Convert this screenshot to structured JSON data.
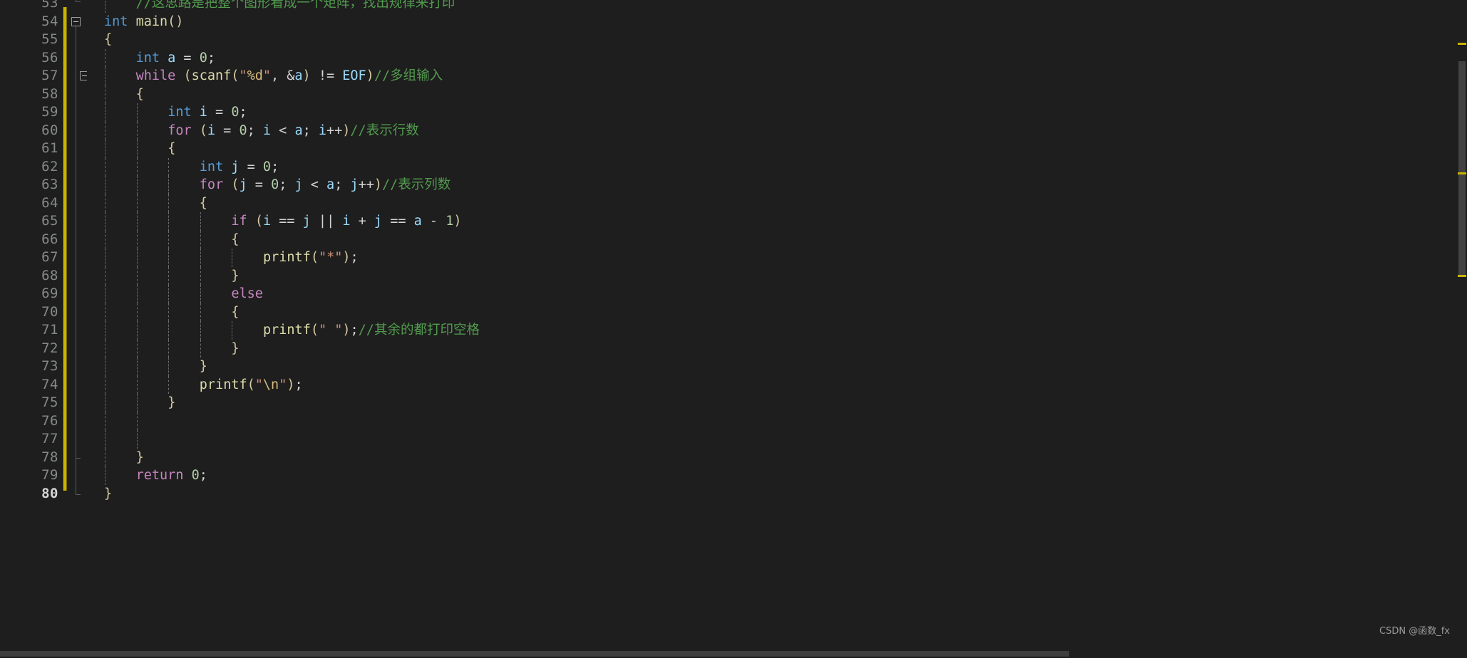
{
  "editor": {
    "theme": "dark-plus",
    "background": "#1e1e1e",
    "gutter_color": "#868989",
    "change_bar_color": "#c8b400",
    "language": "c",
    "first_visible_line": 53,
    "last_visible_line": 80,
    "current_line": 80
  },
  "watermark": {
    "text": "CSDN @函数_fx"
  },
  "scrollbar": {
    "vertical_marks": [
      "#c8b400",
      "#c8b400",
      "#c8b400"
    ]
  },
  "lines": [
    {
      "num": "53",
      "indent": 1,
      "partial": true,
      "tokens": [
        {
          "c": "t-cmt",
          "t": "//这思路是把整个图形看成一个矩阵，找出规律来打印"
        }
      ]
    },
    {
      "num": "54",
      "indent": 0,
      "fold": "start",
      "tokens": [
        {
          "c": "t-type",
          "t": "int"
        },
        {
          "c": "t-plain",
          "t": " "
        },
        {
          "c": "t-fn",
          "t": "main"
        },
        {
          "c": "t-paren",
          "t": "()"
        }
      ]
    },
    {
      "num": "55",
      "indent": 0,
      "tokens": [
        {
          "c": "t-brace",
          "t": "{"
        }
      ]
    },
    {
      "num": "56",
      "indent": 1,
      "tokens": [
        {
          "c": "t-type",
          "t": "int"
        },
        {
          "c": "t-plain",
          "t": " "
        },
        {
          "c": "t-var",
          "t": "a"
        },
        {
          "c": "t-punct",
          "t": " = "
        },
        {
          "c": "t-num",
          "t": "0"
        },
        {
          "c": "t-punct",
          "t": ";"
        }
      ]
    },
    {
      "num": "57",
      "indent": 1,
      "fold": "start",
      "tokens": [
        {
          "c": "t-key",
          "t": "while"
        },
        {
          "c": "t-plain",
          "t": " "
        },
        {
          "c": "t-paren",
          "t": "("
        },
        {
          "c": "t-fn",
          "t": "scanf"
        },
        {
          "c": "t-paren",
          "t": "("
        },
        {
          "c": "t-str",
          "t": "\""
        },
        {
          "c": "t-fmt",
          "t": "%d"
        },
        {
          "c": "t-str",
          "t": "\""
        },
        {
          "c": "t-punct",
          "t": ", "
        },
        {
          "c": "t-punct",
          "t": "&"
        },
        {
          "c": "t-var",
          "t": "a"
        },
        {
          "c": "t-paren",
          "t": ")"
        },
        {
          "c": "t-punct",
          "t": " != "
        },
        {
          "c": "t-var",
          "t": "EOF"
        },
        {
          "c": "t-paren",
          "t": ")"
        },
        {
          "c": "t-cmt",
          "t": "//多组输入"
        }
      ]
    },
    {
      "num": "58",
      "indent": 1,
      "tokens": [
        {
          "c": "t-brace",
          "t": "{"
        }
      ]
    },
    {
      "num": "59",
      "indent": 2,
      "tokens": [
        {
          "c": "t-type",
          "t": "int"
        },
        {
          "c": "t-plain",
          "t": " "
        },
        {
          "c": "t-var",
          "t": "i"
        },
        {
          "c": "t-punct",
          "t": " = "
        },
        {
          "c": "t-num",
          "t": "0"
        },
        {
          "c": "t-punct",
          "t": ";"
        }
      ]
    },
    {
      "num": "60",
      "indent": 2,
      "fold": "start",
      "tokens": [
        {
          "c": "t-key",
          "t": "for"
        },
        {
          "c": "t-plain",
          "t": " "
        },
        {
          "c": "t-paren",
          "t": "("
        },
        {
          "c": "t-var",
          "t": "i"
        },
        {
          "c": "t-punct",
          "t": " = "
        },
        {
          "c": "t-num",
          "t": "0"
        },
        {
          "c": "t-punct",
          "t": "; "
        },
        {
          "c": "t-var",
          "t": "i"
        },
        {
          "c": "t-punct",
          "t": " < "
        },
        {
          "c": "t-var",
          "t": "a"
        },
        {
          "c": "t-punct",
          "t": "; "
        },
        {
          "c": "t-var",
          "t": "i"
        },
        {
          "c": "t-punct",
          "t": "++"
        },
        {
          "c": "t-paren",
          "t": ")"
        },
        {
          "c": "t-cmt",
          "t": "//表示行数"
        }
      ]
    },
    {
      "num": "61",
      "indent": 2,
      "tokens": [
        {
          "c": "t-brace",
          "t": "{"
        }
      ]
    },
    {
      "num": "62",
      "indent": 3,
      "tokens": [
        {
          "c": "t-type",
          "t": "int"
        },
        {
          "c": "t-plain",
          "t": " "
        },
        {
          "c": "t-var",
          "t": "j"
        },
        {
          "c": "t-punct",
          "t": " = "
        },
        {
          "c": "t-num",
          "t": "0"
        },
        {
          "c": "t-punct",
          "t": ";"
        }
      ]
    },
    {
      "num": "63",
      "indent": 3,
      "fold": "start",
      "tokens": [
        {
          "c": "t-key",
          "t": "for"
        },
        {
          "c": "t-plain",
          "t": " "
        },
        {
          "c": "t-paren",
          "t": "("
        },
        {
          "c": "t-var",
          "t": "j"
        },
        {
          "c": "t-punct",
          "t": " = "
        },
        {
          "c": "t-num",
          "t": "0"
        },
        {
          "c": "t-punct",
          "t": "; "
        },
        {
          "c": "t-var",
          "t": "j"
        },
        {
          "c": "t-punct",
          "t": " < "
        },
        {
          "c": "t-var",
          "t": "a"
        },
        {
          "c": "t-punct",
          "t": "; "
        },
        {
          "c": "t-var",
          "t": "j"
        },
        {
          "c": "t-punct",
          "t": "++"
        },
        {
          "c": "t-paren",
          "t": ")"
        },
        {
          "c": "t-cmt",
          "t": "//表示列数"
        }
      ]
    },
    {
      "num": "64",
      "indent": 3,
      "tokens": [
        {
          "c": "t-brace",
          "t": "{"
        }
      ]
    },
    {
      "num": "65",
      "indent": 4,
      "fold": "start",
      "tokens": [
        {
          "c": "t-key",
          "t": "if"
        },
        {
          "c": "t-plain",
          "t": " "
        },
        {
          "c": "t-paren",
          "t": "("
        },
        {
          "c": "t-var",
          "t": "i"
        },
        {
          "c": "t-punct",
          "t": " == "
        },
        {
          "c": "t-var",
          "t": "j"
        },
        {
          "c": "t-punct",
          "t": " || "
        },
        {
          "c": "t-var",
          "t": "i"
        },
        {
          "c": "t-punct",
          "t": " + "
        },
        {
          "c": "t-var",
          "t": "j"
        },
        {
          "c": "t-punct",
          "t": " == "
        },
        {
          "c": "t-var",
          "t": "a"
        },
        {
          "c": "t-punct",
          "t": " - "
        },
        {
          "c": "t-num",
          "t": "1"
        },
        {
          "c": "t-paren",
          "t": ")"
        }
      ]
    },
    {
      "num": "66",
      "indent": 4,
      "tokens": [
        {
          "c": "t-brace",
          "t": "{"
        }
      ]
    },
    {
      "num": "67",
      "indent": 5,
      "tokens": [
        {
          "c": "t-fn",
          "t": "printf"
        },
        {
          "c": "t-paren",
          "t": "("
        },
        {
          "c": "t-str",
          "t": "\"*\""
        },
        {
          "c": "t-paren",
          "t": ")"
        },
        {
          "c": "t-punct",
          "t": ";"
        }
      ]
    },
    {
      "num": "68",
      "indent": 4,
      "tokens": [
        {
          "c": "t-brace",
          "t": "}"
        }
      ]
    },
    {
      "num": "69",
      "indent": 4,
      "fold": "start",
      "tokens": [
        {
          "c": "t-key",
          "t": "else"
        }
      ]
    },
    {
      "num": "70",
      "indent": 4,
      "tokens": [
        {
          "c": "t-brace",
          "t": "{"
        }
      ]
    },
    {
      "num": "71",
      "indent": 5,
      "tokens": [
        {
          "c": "t-fn",
          "t": "printf"
        },
        {
          "c": "t-paren",
          "t": "("
        },
        {
          "c": "t-str",
          "t": "\" \""
        },
        {
          "c": "t-paren",
          "t": ")"
        },
        {
          "c": "t-punct",
          "t": ";"
        },
        {
          "c": "t-cmt",
          "t": "//其余的都打印空格"
        }
      ]
    },
    {
      "num": "72",
      "indent": 4,
      "tokens": [
        {
          "c": "t-brace",
          "t": "}"
        }
      ]
    },
    {
      "num": "73",
      "indent": 3,
      "tokens": [
        {
          "c": "t-brace",
          "t": "}"
        }
      ]
    },
    {
      "num": "74",
      "indent": 3,
      "tokens": [
        {
          "c": "t-fn",
          "t": "printf"
        },
        {
          "c": "t-paren",
          "t": "("
        },
        {
          "c": "t-str",
          "t": "\""
        },
        {
          "c": "t-fmt",
          "t": "\\n"
        },
        {
          "c": "t-str",
          "t": "\""
        },
        {
          "c": "t-paren",
          "t": ")"
        },
        {
          "c": "t-punct",
          "t": ";"
        }
      ]
    },
    {
      "num": "75",
      "indent": 2,
      "tokens": [
        {
          "c": "t-brace",
          "t": "}"
        }
      ]
    },
    {
      "num": "76",
      "indent": 2,
      "tokens": []
    },
    {
      "num": "77",
      "indent": 2,
      "tokens": []
    },
    {
      "num": "78",
      "indent": 1,
      "tokens": [
        {
          "c": "t-brace",
          "t": "}"
        }
      ]
    },
    {
      "num": "79",
      "indent": 1,
      "tokens": [
        {
          "c": "t-key",
          "t": "return"
        },
        {
          "c": "t-plain",
          "t": " "
        },
        {
          "c": "t-num",
          "t": "0"
        },
        {
          "c": "t-punct",
          "t": ";"
        }
      ]
    },
    {
      "num": "80",
      "indent": 0,
      "current": true,
      "tokens": [
        {
          "c": "t-brace",
          "t": "}"
        }
      ]
    }
  ]
}
